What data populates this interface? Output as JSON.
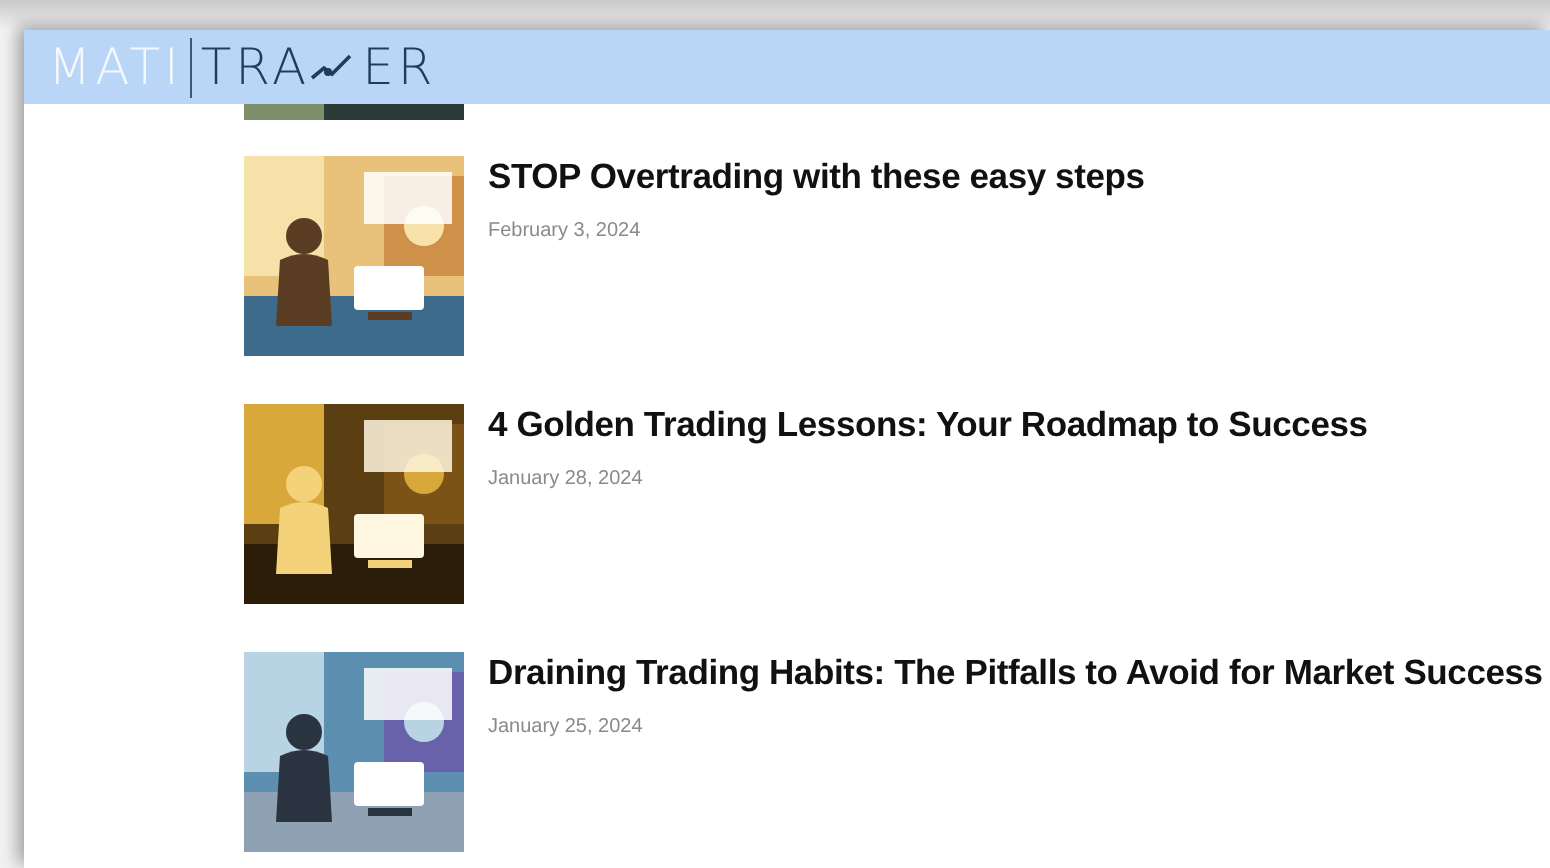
{
  "header": {
    "logo": {
      "left": "MATI",
      "right_start": "TRA",
      "right_end": "ER"
    }
  },
  "posts": [
    {
      "title": "STOP Overtrading with these easy steps",
      "date": "February 3, 2024"
    },
    {
      "title": "4 Golden Trading Lessons: Your Roadmap to Success",
      "date": "January 28, 2024"
    },
    {
      "title": "Draining Trading Habits: The Pitfalls to Avoid for Market Success",
      "date": "January 25, 2024"
    }
  ]
}
